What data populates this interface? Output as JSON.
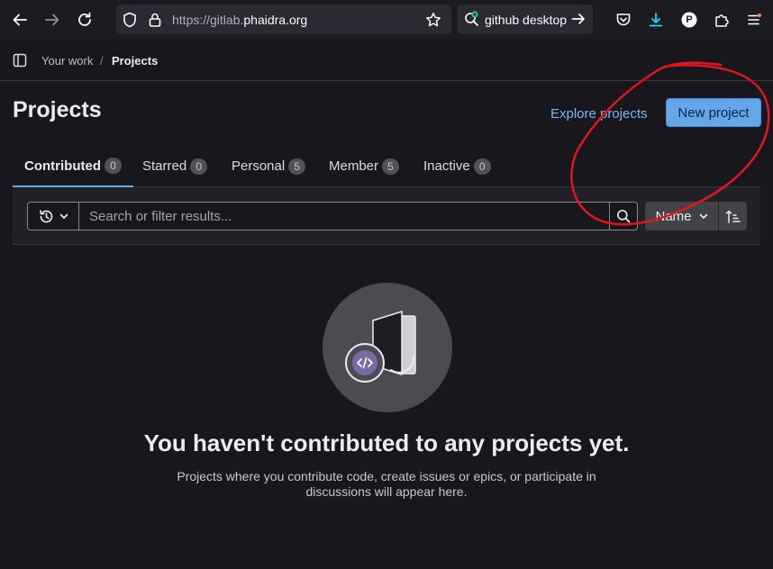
{
  "browser": {
    "url_prefix": "https://gitlab.",
    "url_host": "phaidra.org",
    "search_text": "github desktop",
    "profile_letter": "P"
  },
  "breadcrumb": {
    "parent": "Your work",
    "separator": "/",
    "current": "Projects"
  },
  "page": {
    "title": "Projects",
    "explore_label": "Explore projects",
    "new_project_label": "New project"
  },
  "tabs": [
    {
      "label": "Contributed",
      "count": "0",
      "active": true
    },
    {
      "label": "Starred",
      "count": "0"
    },
    {
      "label": "Personal",
      "count": "5"
    },
    {
      "label": "Member",
      "count": "5"
    },
    {
      "label": "Inactive",
      "count": "0"
    }
  ],
  "filter": {
    "placeholder": "Search or filter results...",
    "sort_label": "Name"
  },
  "empty_state": {
    "title": "You haven't contributed to any projects yet.",
    "description": "Projects where you contribute code, create issues or epics, or participate in discussions will appear here."
  },
  "colors": {
    "accent": "#63a6e9",
    "link": "#7fb6ed",
    "annotation": "#e0161c",
    "background": "#18171d"
  },
  "icons": {
    "history": "history-icon",
    "search": "search-icon",
    "sort_direction": "sort-ascending-icon",
    "illustration": "empty-projects-illustration"
  }
}
